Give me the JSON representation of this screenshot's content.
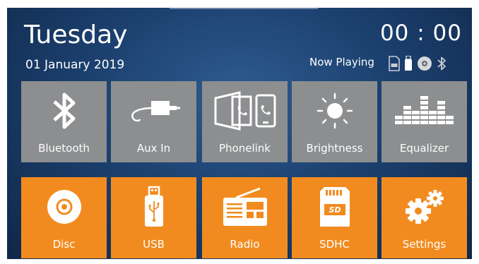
{
  "header": {
    "day": "Tuesday",
    "date": "01 January 2019",
    "time": "00 : 00",
    "now_playing": "Now Playing"
  },
  "status_icons": [
    "sdhc-icon",
    "usb-icon",
    "disc-icon",
    "bluetooth-icon"
  ],
  "tiles_top": [
    {
      "label": "Bluetooth",
      "icon": "bluetooth-icon"
    },
    {
      "label": "Aux In",
      "icon": "aux-cable-icon"
    },
    {
      "label": "Phonelink",
      "icon": "phonelink-icon"
    },
    {
      "label": "Brightness",
      "icon": "sun-icon"
    },
    {
      "label": "Equalizer",
      "icon": "equalizer-icon"
    }
  ],
  "tiles_bottom": [
    {
      "label": "Disc",
      "icon": "disc-icon"
    },
    {
      "label": "USB",
      "icon": "usb-icon"
    },
    {
      "label": "Radio",
      "icon": "radio-icon"
    },
    {
      "label": "SDHC",
      "icon": "sdhc-icon"
    },
    {
      "label": "Settings",
      "icon": "gears-icon"
    }
  ],
  "colors": {
    "background": "#1c4170",
    "top_tile": "#8c8e90",
    "bottom_tile": "#f28b1f",
    "text": "#ffffff"
  }
}
